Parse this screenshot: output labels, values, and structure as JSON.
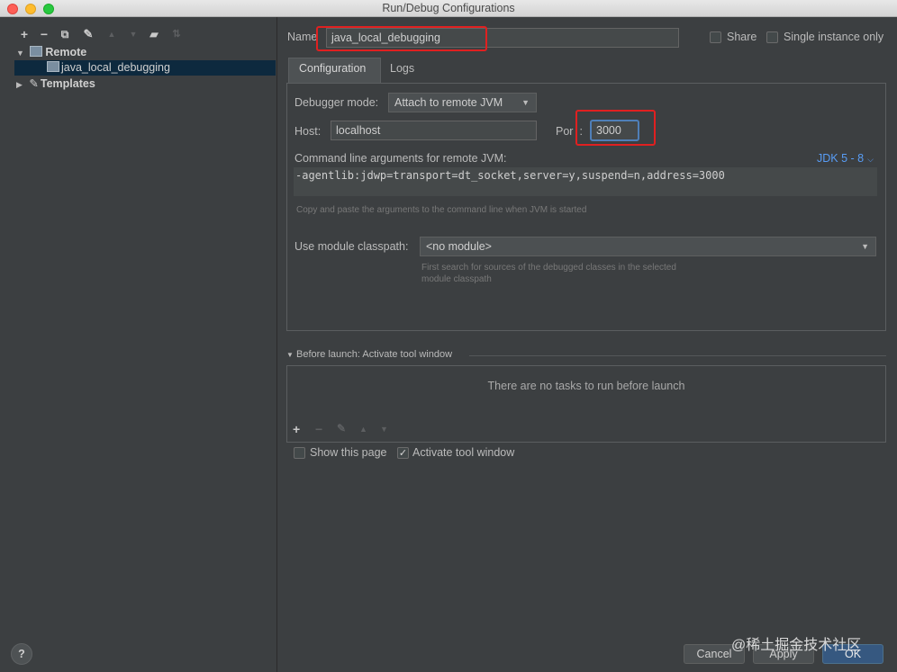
{
  "window": {
    "title": "Run/Debug Configurations"
  },
  "tree": {
    "items": [
      {
        "label": "Remote"
      },
      {
        "label": "java_local_debugging"
      },
      {
        "label": "Templates"
      }
    ]
  },
  "header": {
    "name_label": "Name",
    "name_value": "java_local_debugging",
    "share_label": "Share",
    "single_instance_label": "Single instance only"
  },
  "tabs": [
    {
      "label": "Configuration"
    },
    {
      "label": "Logs"
    }
  ],
  "config": {
    "debugger_mode_label": "Debugger mode:",
    "debugger_mode_value": "Attach to remote JVM",
    "host_label": "Host:",
    "host_value": "localhost",
    "port_label_a": "Por",
    "port_label_b": ":",
    "port_value": "3000",
    "cmd_label": "Command line arguments for remote JVM:",
    "jdk_link": "JDK 5 - 8",
    "cmd_value": "-agentlib:jdwp=transport=dt_socket,server=y,suspend=n,address=3000",
    "cmd_hint": "Copy and paste the arguments to the command line when JVM is started",
    "module_label": "Use module classpath:",
    "module_value": "<no module>",
    "module_hint_1": "First search for sources of the debugged classes in the selected",
    "module_hint_2": "module classpath"
  },
  "before_launch": {
    "title": "Before launch: Activate tool window",
    "empty_text": "There are no tasks to run before launch",
    "show_page_label": "Show this page",
    "activate_label": "Activate tool window"
  },
  "footer": {
    "help": "?",
    "cancel": "Cancel",
    "apply": "Apply",
    "ok": "OK",
    "watermark": "@稀土掘金技术社区"
  },
  "colors": {
    "accent": "#365880",
    "link": "#589df6",
    "highlight": "#e02020"
  }
}
